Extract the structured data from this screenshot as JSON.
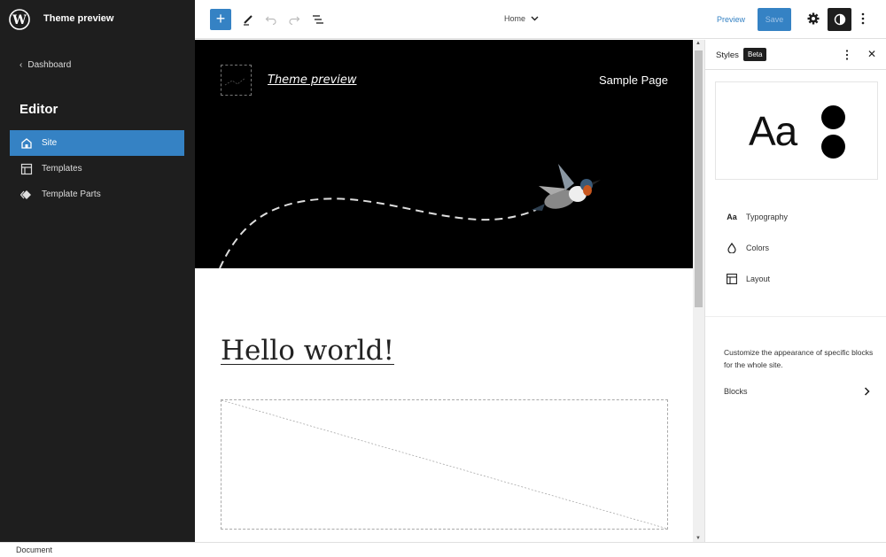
{
  "sidebar": {
    "site_title": "Theme preview",
    "back_link": "Dashboard",
    "heading": "Editor",
    "items": [
      {
        "label": "Site",
        "icon": "home-icon",
        "active": true
      },
      {
        "label": "Templates",
        "icon": "layout-icon",
        "active": false
      },
      {
        "label": "Template Parts",
        "icon": "symbol-icon",
        "active": false
      }
    ]
  },
  "topbar": {
    "document_title": "Home",
    "preview_label": "Preview",
    "save_label": "Save",
    "accent_color": "#3582c4"
  },
  "canvas": {
    "site_title_link": "Theme preview",
    "nav_link": "Sample Page",
    "post_title": "Hello world!"
  },
  "styles_panel": {
    "title": "Styles",
    "badge": "Beta",
    "preview_text": "Aa",
    "items": [
      {
        "label": "Typography",
        "icon": "typography-icon",
        "glyph": "Aa"
      },
      {
        "label": "Colors",
        "icon": "droplet-icon",
        "glyph": "💧"
      },
      {
        "label": "Layout",
        "icon": "layout-icon",
        "glyph": ""
      }
    ],
    "description": "Customize the appearance of specific blocks for the whole site.",
    "blocks_label": "Blocks"
  },
  "statusbar": {
    "text": "Document"
  }
}
